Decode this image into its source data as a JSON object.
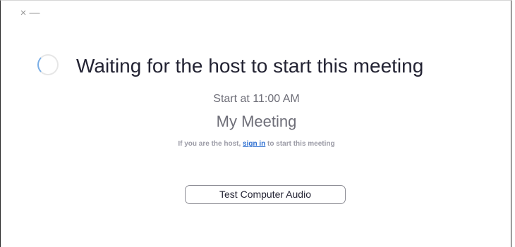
{
  "window": {
    "close_glyph": "×",
    "minimize_glyph": "—"
  },
  "status": {
    "headline": "Waiting for the host to start this meeting",
    "spinner_icon": "loading-spinner-icon"
  },
  "meeting": {
    "start_time": "Start at 11:00 AM",
    "title": "My Meeting"
  },
  "host_note": {
    "prefix": "If you are the host, ",
    "link_text": "sign in",
    "suffix": " to start this meeting"
  },
  "actions": {
    "test_audio_label": "Test Computer Audio"
  },
  "colors": {
    "link": "#2d6fd1",
    "text_dark": "#232333",
    "text_muted": "#6e6e78",
    "spinner_accent": "#7aaee6"
  }
}
